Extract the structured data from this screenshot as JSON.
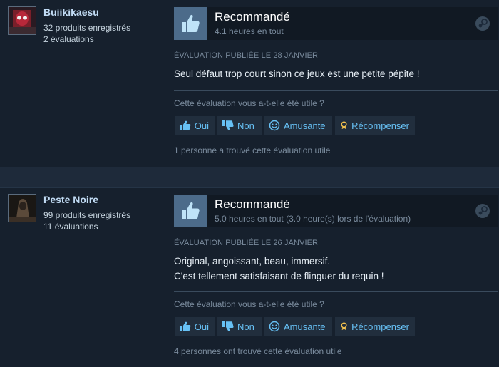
{
  "colors": {
    "accent": "#67c1f5",
    "thumb_bg": "#4c6b8a",
    "background": "#1b2838"
  },
  "reviews": [
    {
      "user": {
        "name": "Buiikikaesu",
        "products": "32 produits enregistrés",
        "reviews": "2 évaluations"
      },
      "vote": {
        "title": "Recommandé",
        "hours": "4.1 heures en tout"
      },
      "posted": "ÉVALUATION PUBLIÉE LE 28 JANVIER",
      "text_lines": [
        "Seul défaut trop court sinon ce jeux est une petite pépite !"
      ],
      "helpful_question": "Cette évaluation vous a-t-elle été utile ?",
      "buttons": {
        "yes": "Oui",
        "no": "Non",
        "funny": "Amusante",
        "award": "Récompenser"
      },
      "helpful_count": "1 personne a trouvé cette évaluation utile"
    },
    {
      "user": {
        "name": "Peste Noire",
        "products": "99 produits enregistrés",
        "reviews": "11 évaluations"
      },
      "vote": {
        "title": "Recommandé",
        "hours": "5.0 heures en tout (3.0 heure(s) lors de l'évaluation)"
      },
      "posted": "ÉVALUATION PUBLIÉE LE 26 JANVIER",
      "text_lines": [
        "Original, angoissant, beau, immersif.",
        "C'est tellement satisfaisant de flinguer du requin !"
      ],
      "helpful_question": "Cette évaluation vous a-t-elle été utile ?",
      "buttons": {
        "yes": "Oui",
        "no": "Non",
        "funny": "Amusante",
        "award": "Récompenser"
      },
      "helpful_count": "4 personnes ont trouvé cette évaluation utile"
    }
  ]
}
